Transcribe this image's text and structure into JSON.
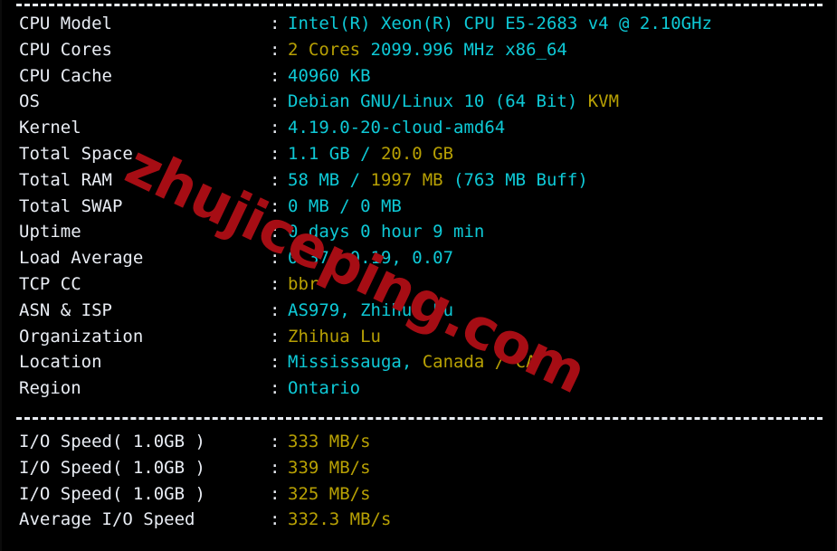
{
  "terminal": {
    "background_color": "#000000",
    "separator_top": "----------------------------------------------------------------------",
    "separator_middle": "----------------------------------------------------------------------"
  },
  "colors": {
    "label": "#e9edf4",
    "cyan": "#0ec9d6",
    "yellow": "#b7a004",
    "watermark": "#a60d14"
  },
  "watermark": {
    "text": "zhujiceping.com"
  },
  "system_info": {
    "rows": [
      {
        "label": "CPU Model",
        "colon": ":",
        "segments": [
          {
            "text": "Intel(R) Xeon(R) CPU E5-2683 v4 @ 2.10GHz",
            "color": "cyan"
          }
        ],
        "value_plain": "Intel(R) Xeon(R) CPU E5-2683 v4 @ 2.10GHz"
      },
      {
        "label": "CPU Cores",
        "colon": ":",
        "segments": [
          {
            "text": "2 Cores ",
            "color": "yellow"
          },
          {
            "text": "2099.996 MHz x86_64",
            "color": "cyan"
          }
        ],
        "value_plain": "2 Cores 2099.996 MHz x86_64"
      },
      {
        "label": "CPU Cache",
        "colon": ":",
        "segments": [
          {
            "text": "40960 KB",
            "color": "cyan"
          }
        ],
        "value_plain": "40960 KB"
      },
      {
        "label": "OS",
        "colon": ":",
        "segments": [
          {
            "text": "Debian GNU/Linux 10 (64 Bit) ",
            "color": "cyan"
          },
          {
            "text": "KVM",
            "color": "yellow"
          }
        ],
        "value_plain": "Debian GNU/Linux 10 (64 Bit) KVM"
      },
      {
        "label": "Kernel",
        "colon": ":",
        "segments": [
          {
            "text": "4.19.0-20-cloud-amd64",
            "color": "cyan"
          }
        ],
        "value_plain": "4.19.0-20-cloud-amd64"
      },
      {
        "label": "Total Space",
        "colon": ":",
        "segments": [
          {
            "text": "1.1 GB ",
            "color": "cyan"
          },
          {
            "text": "/ ",
            "color": "cyan"
          },
          {
            "text": "20.0 GB",
            "color": "yellow"
          }
        ],
        "value_plain": "1.1 GB / 20.0 GB"
      },
      {
        "label": "Total RAM",
        "colon": ":",
        "segments": [
          {
            "text": "58 MB ",
            "color": "cyan"
          },
          {
            "text": "/ ",
            "color": "cyan"
          },
          {
            "text": "1997 MB ",
            "color": "yellow"
          },
          {
            "text": "(763 MB Buff)",
            "color": "cyan"
          }
        ],
        "value_plain": "58 MB / 1997 MB (763 MB Buff)"
      },
      {
        "label": "Total SWAP",
        "colon": ":",
        "segments": [
          {
            "text": "0 MB / 0 MB",
            "color": "cyan"
          }
        ],
        "value_plain": "0 MB / 0 MB"
      },
      {
        "label": "Uptime",
        "colon": ":",
        "segments": [
          {
            "text": "0 days 0 hour 9 min",
            "color": "cyan"
          }
        ],
        "value_plain": "0 days 0 hour 9 min"
      },
      {
        "label": "Load Average",
        "colon": ":",
        "segments": [
          {
            "text": "0.37, 0.19, 0.07",
            "color": "cyan"
          }
        ],
        "value_plain": "0.37, 0.19, 0.07"
      },
      {
        "label": "TCP CC",
        "colon": ":",
        "segments": [
          {
            "text": "bbr",
            "color": "yellow"
          }
        ],
        "value_plain": "bbr"
      },
      {
        "label": "ASN & ISP",
        "colon": ":",
        "segments": [
          {
            "text": "AS979, Zhihua Lu",
            "color": "cyan"
          }
        ],
        "value_plain": "AS979, Zhihua Lu"
      },
      {
        "label": "Organization",
        "colon": ":",
        "segments": [
          {
            "text": "Zhihua Lu",
            "color": "yellow"
          }
        ],
        "value_plain": "Zhihua Lu"
      },
      {
        "label": "Location",
        "colon": ":",
        "segments": [
          {
            "text": "Mississauga, ",
            "color": "cyan"
          },
          {
            "text": "Canada / CA",
            "color": "yellow"
          }
        ],
        "value_plain": "Mississauga, Canada / CA"
      },
      {
        "label": "Region",
        "colon": ":",
        "segments": [
          {
            "text": "Ontario",
            "color": "cyan"
          }
        ],
        "value_plain": "Ontario"
      }
    ]
  },
  "io_test": {
    "rows": [
      {
        "label": "I/O Speed( 1.0GB )",
        "colon": ":",
        "segments": [
          {
            "text": "333 MB/s",
            "color": "yellow"
          }
        ],
        "value_plain": "333 MB/s"
      },
      {
        "label": "I/O Speed( 1.0GB )",
        "colon": ":",
        "segments": [
          {
            "text": "339 MB/s",
            "color": "yellow"
          }
        ],
        "value_plain": "339 MB/s"
      },
      {
        "label": "I/O Speed( 1.0GB )",
        "colon": ":",
        "segments": [
          {
            "text": "325 MB/s",
            "color": "yellow"
          }
        ],
        "value_plain": "325 MB/s"
      },
      {
        "label": "Average I/O Speed",
        "colon": ":",
        "segments": [
          {
            "text": "332.3 MB/s",
            "color": "yellow"
          }
        ],
        "value_plain": "332.3 MB/s"
      }
    ]
  }
}
